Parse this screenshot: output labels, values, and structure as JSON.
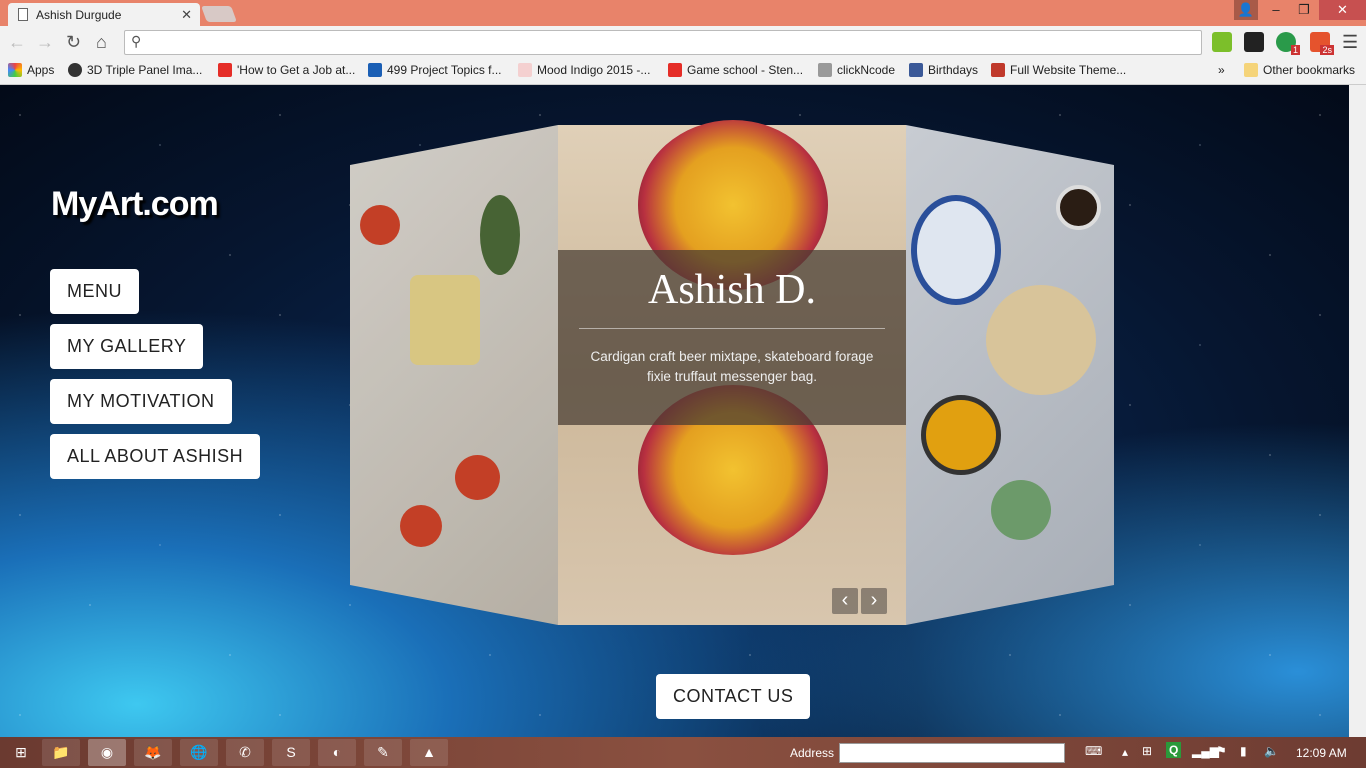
{
  "browser": {
    "tab_title": "Ashish Durgude",
    "address": "",
    "bookmarks": [
      {
        "label": "Apps",
        "icon": "apps-grid-icon"
      },
      {
        "label": "3D Triple Panel Ima...",
        "icon": "codrops-icon"
      },
      {
        "label": "'How to Get a Job at...",
        "icon": "youtube-icon"
      },
      {
        "label": "499 Project Topics f...",
        "icon": "checkmark-icon"
      },
      {
        "label": "Mood Indigo 2015 -...",
        "icon": "mood-indigo-icon"
      },
      {
        "label": "Game school - Sten...",
        "icon": "youtube-icon"
      },
      {
        "label": "clickNcode",
        "icon": "monitor-code-icon"
      },
      {
        "label": "Birthdays",
        "icon": "facebook-icon"
      },
      {
        "label": "Full Website Theme...",
        "icon": "s-logo-icon"
      }
    ],
    "other_bookmarks": "Other bookmarks",
    "overflow": "»",
    "ext_badges": [
      "1",
      "2s"
    ]
  },
  "site": {
    "logo": "MyArt.com",
    "nav": [
      "MENU",
      "MY GALLERY",
      "MY MOTIVATION",
      "ALL ABOUT ASHISH"
    ],
    "slide": {
      "title": "Ashish D.",
      "caption": "Cardigan craft beer mixtape, skateboard forage fixie truffaut messenger bag."
    },
    "contact": "CONTACT US"
  },
  "taskbar": {
    "address_label": "Address",
    "clock": "12:09 AM"
  },
  "colors": {
    "titlebar": "#e8836a",
    "close": "#c75050"
  }
}
